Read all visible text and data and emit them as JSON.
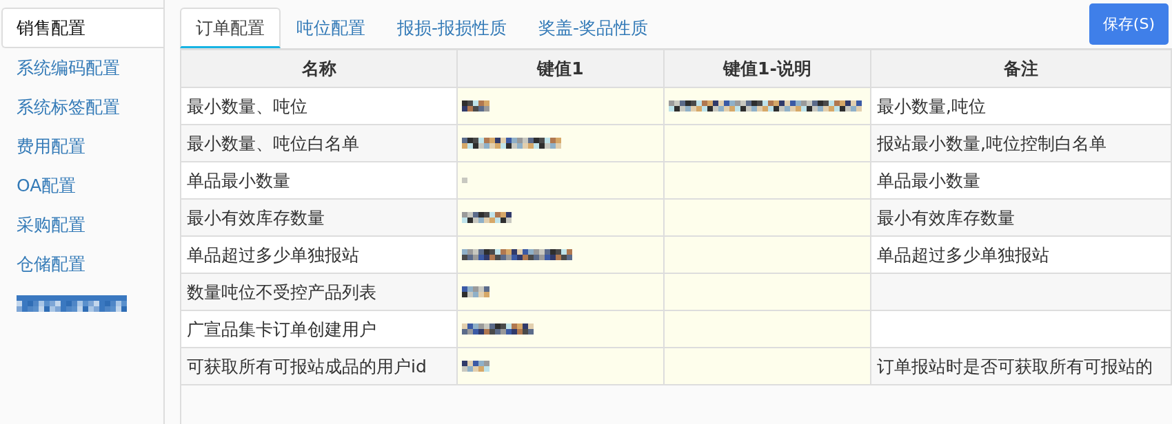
{
  "sidebar": {
    "items": [
      {
        "label": "销售配置",
        "selected": true
      },
      {
        "label": "系统编码配置",
        "selected": false
      },
      {
        "label": "系统标签配置",
        "selected": false
      },
      {
        "label": "费用配置",
        "selected": false
      },
      {
        "label": "OA配置",
        "selected": false
      },
      {
        "label": "采购配置",
        "selected": false
      },
      {
        "label": "仓储配置",
        "selected": false
      },
      {
        "redacted": true,
        "selected": false
      }
    ]
  },
  "tabs": [
    {
      "label": "订单配置",
      "selected": true
    },
    {
      "label": "吨位配置",
      "selected": false
    },
    {
      "label": "报损-报损性质",
      "selected": false
    },
    {
      "label": "奖盖-奖品性质",
      "selected": false
    }
  ],
  "save_button": {
    "label": "保存(S)"
  },
  "table": {
    "columns": [
      "名称",
      "键值1",
      "键值1-说明",
      "备注"
    ],
    "rows": [
      {
        "name": "最小数量、吨位",
        "key_1": {
          "redacted": true
        },
        "key_1_description": {
          "redacted": true
        },
        "remark": "最小数量,吨位"
      },
      {
        "name": "最小数量、吨位白名单",
        "key_1": {
          "redacted": true
        },
        "remark": "报站最小数量,吨位控制白名单"
      },
      {
        "name": "单品最小数量",
        "key_1": {
          "redacted": true
        },
        "remark": "单品最小数量"
      },
      {
        "name": "最小有效库存数量",
        "key_1": {
          "redacted": true
        },
        "remark": "最小有效库存数量"
      },
      {
        "name": "单品超过多少单独报站",
        "key_1": {
          "redacted": true
        },
        "remark": "单品超过多少单独报站"
      },
      {
        "name": "数量吨位不受控产品列表",
        "key_1": {
          "redacted": true
        }
      },
      {
        "name": "广宣品集卡订单创建用户",
        "key_1": {
          "redacted": true
        }
      },
      {
        "name": "可获取所有可报站成品的用户id",
        "key_1": {
          "redacted": true
        },
        "remark": "订单报站时是否可获取所有可报站的"
      }
    ]
  }
}
